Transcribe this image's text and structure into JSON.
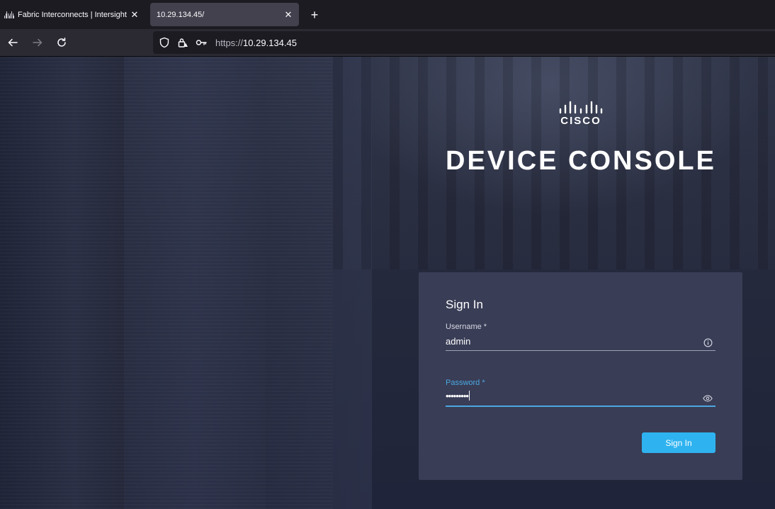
{
  "browser": {
    "tabs": [
      {
        "title": "Fabric Interconnects | Intersight",
        "active": false
      },
      {
        "title": "10.29.134.45/",
        "active": true
      }
    ],
    "url": {
      "scheme": "https://",
      "host": "10.29.134.45"
    },
    "icons": {
      "back": "arrow-left-icon",
      "forward": "arrow-right-icon",
      "reload": "reload-icon",
      "shield": "shield-icon",
      "lock": "lock-warning-icon",
      "key": "key-icon",
      "new_tab": "plus-icon",
      "close_tab": "close-icon"
    }
  },
  "page": {
    "brand": "CISCO",
    "title": "DEVICE CONSOLE",
    "form": {
      "heading": "Sign In",
      "username": {
        "label": "Username *",
        "value": "admin",
        "icon": "info-icon"
      },
      "password": {
        "label": "Password *",
        "value": "•••••••••",
        "icon": "eye-icon",
        "focused": true
      },
      "submit_label": "Sign In"
    }
  },
  "colors": {
    "accent": "#2fb3f0",
    "focus": "#4aa8e0",
    "card": "#393d56"
  }
}
